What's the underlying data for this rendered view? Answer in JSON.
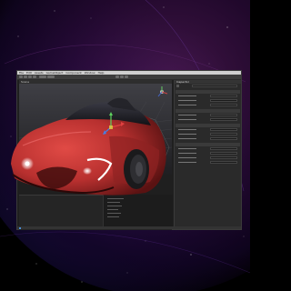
{
  "window": {
    "menu": [
      "File",
      "Edit",
      "Assets",
      "GameObject",
      "Component",
      "Window",
      "Help"
    ],
    "scene_tab": "Scene",
    "inspector_tab": "Inspector"
  },
  "colors": {
    "car_body": "#b8302f",
    "headlight": "#ffffff",
    "accent": "#4a90d9",
    "editor_bg": "#2a2a2a"
  },
  "icons": [
    "move-gizmo-icon",
    "play-icon",
    "pause-icon",
    "step-icon"
  ]
}
